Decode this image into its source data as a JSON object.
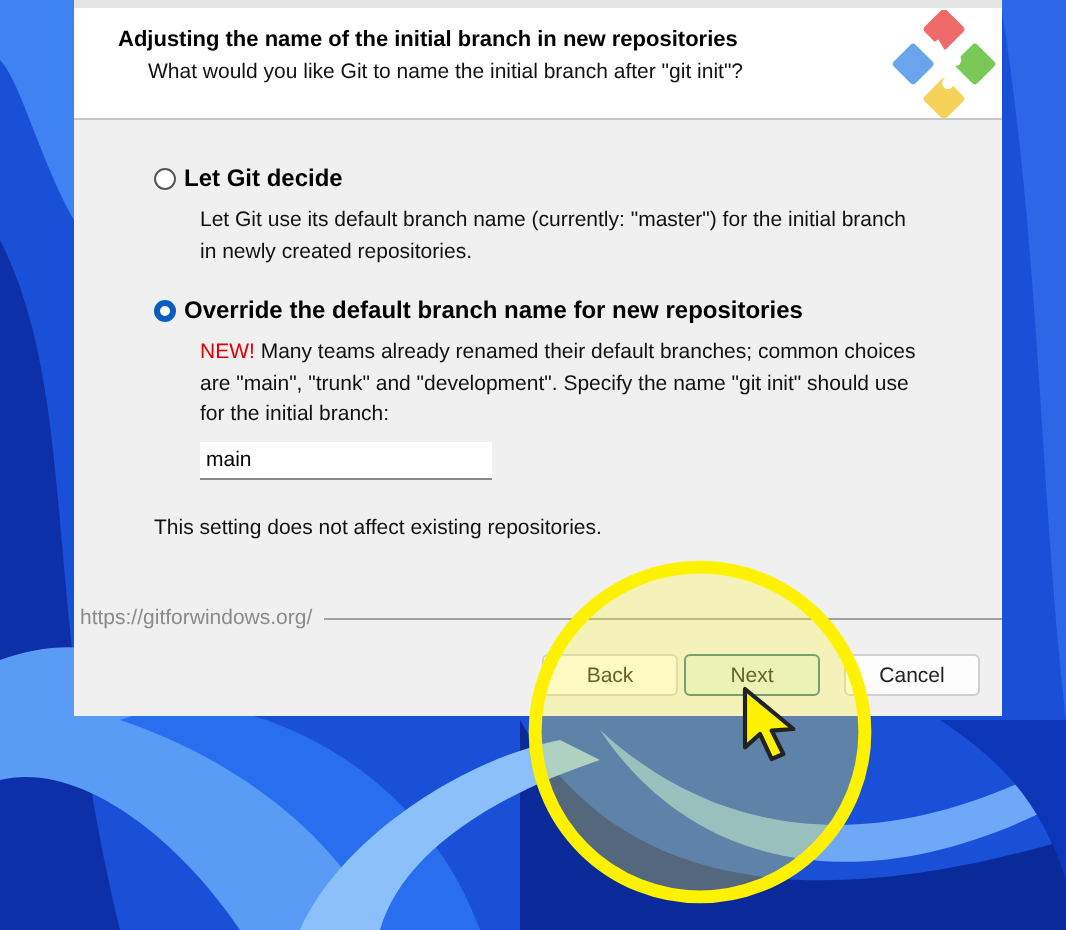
{
  "dialog": {
    "header": {
      "title": "Adjusting the name of the initial branch in new repositories",
      "subtitle": "What would you like Git to name the initial branch after \"git init\"?"
    },
    "options": [
      {
        "label": "Let Git decide",
        "selected": false,
        "description": "Let Git use its default branch name (currently: \"master\") for the initial branch\nin newly created repositories."
      },
      {
        "label": "Override the default branch name for new repositories",
        "selected": true,
        "tag": "NEW!",
        "description": "Many teams already renamed their default branches; common choices\nare \"main\", \"trunk\" and \"development\". Specify the name \"git init\" should use\nfor the initial branch:"
      }
    ],
    "branch_field": {
      "value": "main"
    },
    "note": "This setting does not affect existing repositories.",
    "footer_link": "https://gitforwindows.org/",
    "buttons": [
      {
        "label": "Back",
        "default": false
      },
      {
        "label": "Next",
        "default": true
      },
      {
        "label": "Cancel",
        "default": false
      }
    ]
  }
}
